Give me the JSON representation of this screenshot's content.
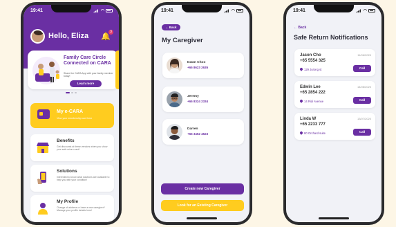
{
  "phone_home": {
    "status_time": "19:41",
    "greeting": "Hello, Eliza",
    "notification_count": "3",
    "banner": {
      "title": "Family Care Circle Connected on CARA",
      "subtitle": "Share the CARA App with your family member today!",
      "button": "Learn more"
    },
    "ecara": {
      "title": "My e-CARA",
      "subtitle": "View your membership card here"
    },
    "menu": [
      {
        "title": "Benefits",
        "subtitle": "Get discounts at these vendors when you show your safe return card!"
      },
      {
        "title": "Solutions",
        "subtitle": "Interested to know what solutions are available to help you with your condition!"
      },
      {
        "title": "My Profile",
        "subtitle": "Change of address or have a new caregiver? Manage your profile details here!"
      }
    ]
  },
  "phone_caregiver": {
    "status_time": "19:41",
    "back_label": "← Back",
    "title": "My Caregiver",
    "caregivers": [
      {
        "name": "Dawn Choo",
        "phone": "+65 8623 2635"
      },
      {
        "name": "Jeremy",
        "phone": "+65 8324 2334"
      },
      {
        "name": "Darren",
        "phone": "+65 3452 4523"
      }
    ],
    "create_button": "Create new Caregiver",
    "look_button": "Look for an Existing Caregiver"
  },
  "phone_safe_return": {
    "status_time": "19:41",
    "back_label": "← Back",
    "title": "Safe Return Notifications",
    "notifications": [
      {
        "name": "Jason Cho",
        "phone": "+65 5554 325",
        "date": "11/06/2020",
        "location": "129 Jurong st",
        "action": "Call"
      },
      {
        "name": "Edwin Lee",
        "phone": "+65 2854 222",
        "date": "14/08/2020",
        "location": "14 Ridi Avenue",
        "action": "Call"
      },
      {
        "name": "Linda W",
        "phone": "+65 2233 777",
        "date": "13/07/2020",
        "location": "80 Orchard suite",
        "action": "Call"
      }
    ]
  },
  "colors": {
    "purple": "#6a2fa3",
    "yellow": "#ffcc1f",
    "background": "#fdf6e6"
  }
}
